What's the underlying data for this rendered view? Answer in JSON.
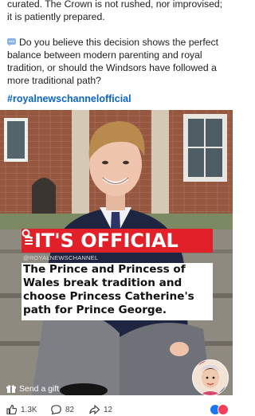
{
  "post": {
    "paragraph1": "curated. The Crown is not rushed, nor improvised; it is patiently prepared.",
    "paragraph2_emoji": "speech-bubble-icon",
    "paragraph2": "Do you believe this decision shows the perfect balance between modern parenting and royal tradition, or should the Windsors have followed a more traditional path?",
    "hashtag": "#royalnewschannelofficial"
  },
  "image": {
    "banner": "IT'S OFFICIAL",
    "channel": "@ROYALNEWSCHANNEL",
    "headline": "The Prince and Princess of Wales break tradition and choose Princess Catherine's path for Prince George.",
    "banner_color": "#e2202a"
  },
  "gift": {
    "label": "Send a gift",
    "icon": "gift-icon"
  },
  "actions": {
    "like_count": "1.3K",
    "comment_count": "82",
    "share_count": "12"
  },
  "colors": {
    "hashtag": "#0b65c8"
  }
}
